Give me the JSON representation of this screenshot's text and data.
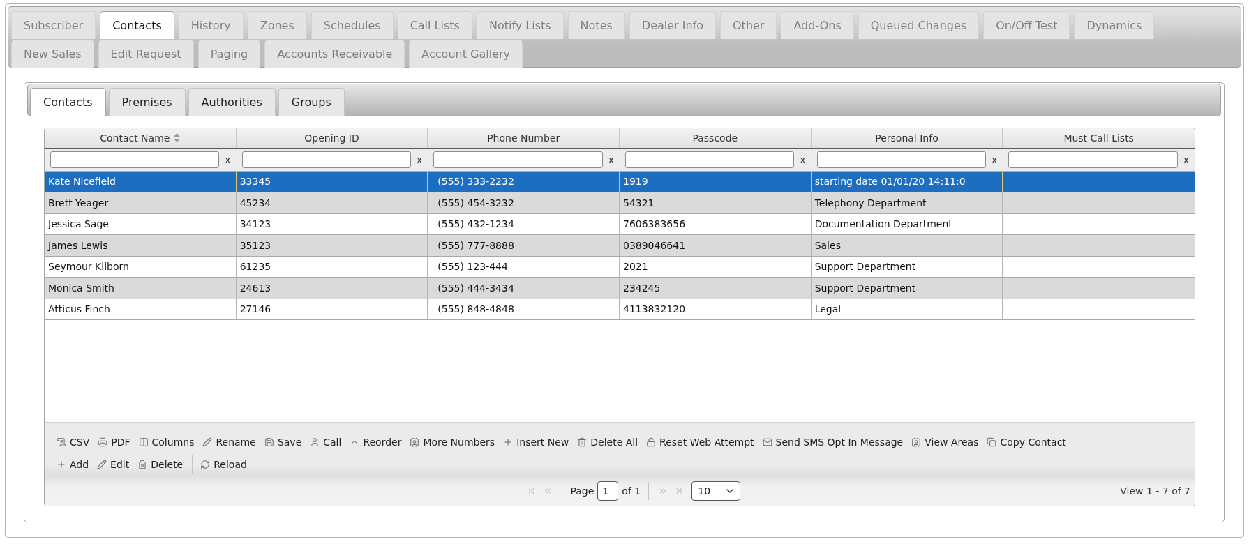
{
  "account_tabs": [
    {
      "label": "Subscriber",
      "selected": false
    },
    {
      "label": "Contacts",
      "selected": true
    },
    {
      "label": "History",
      "selected": false
    },
    {
      "label": "Zones",
      "selected": false
    },
    {
      "label": "Schedules",
      "selected": false
    },
    {
      "label": "Call Lists",
      "selected": false
    },
    {
      "label": "Notify Lists",
      "selected": false
    },
    {
      "label": "Notes",
      "selected": false
    },
    {
      "label": "Dealer Info",
      "selected": false
    },
    {
      "label": "Other",
      "selected": false
    },
    {
      "label": "Add-Ons",
      "selected": false
    },
    {
      "label": "Queued Changes",
      "selected": false
    },
    {
      "label": "On/Off Test",
      "selected": false
    },
    {
      "label": "Dynamics",
      "selected": false
    },
    {
      "label": "New Sales",
      "selected": false
    },
    {
      "label": "Edit Request",
      "selected": false
    },
    {
      "label": "Paging",
      "selected": false
    },
    {
      "label": "Accounts Receivable",
      "selected": false
    },
    {
      "label": "Account Gallery",
      "selected": false
    }
  ],
  "contact_tabs": [
    {
      "label": "Contacts",
      "selected": true
    },
    {
      "label": "Premises",
      "selected": false
    },
    {
      "label": "Authorities",
      "selected": false
    },
    {
      "label": "Groups",
      "selected": false
    }
  ],
  "grid": {
    "columns": [
      {
        "label": "Contact Name",
        "sorted": true,
        "filter": {
          "clear": "x"
        }
      },
      {
        "label": "Opening ID",
        "sorted": false,
        "filter": {
          "clear": "x"
        }
      },
      {
        "label": "Phone Number",
        "sorted": false,
        "filter": {
          "clear": "x"
        }
      },
      {
        "label": "Passcode",
        "sorted": false,
        "filter": {
          "clear": "x"
        }
      },
      {
        "label": "Personal Info",
        "sorted": false,
        "filter": {
          "clear": "x"
        }
      },
      {
        "label": "Must Call Lists",
        "sorted": false,
        "filter": {
          "clear": "x"
        }
      }
    ],
    "rows": [
      {
        "selected": true,
        "cells": [
          "Kate Nicefield",
          "33345",
          "(555) 333-2232",
          "1919",
          "starting date 01/01/20 14:11:0"
        ]
      },
      {
        "selected": false,
        "cells": [
          "Brett Yeager",
          "45234",
          "(555) 454-3232",
          "54321",
          "Telephony Department"
        ]
      },
      {
        "selected": false,
        "cells": [
          "Jessica Sage",
          "34123",
          "(555) 432-1234",
          "7606383656",
          "Documentation Department"
        ]
      },
      {
        "selected": false,
        "cells": [
          "James Lewis",
          "35123",
          "(555) 777-8888",
          "0389046641",
          "Sales"
        ]
      },
      {
        "selected": false,
        "cells": [
          "Seymour Kilborn",
          "61235",
          "(555) 123-444",
          "2021",
          "Support Department"
        ]
      },
      {
        "selected": false,
        "cells": [
          "Monica Smith",
          "24613",
          "(555) 444-3434",
          "234245",
          "Support Department"
        ]
      },
      {
        "selected": false,
        "cells": [
          "Atticus Finch",
          "27146",
          "(555) 848-4848",
          "4113832120",
          "Legal"
        ]
      }
    ]
  },
  "toolbar": {
    "rows": [
      {
        "groups": [
          [
            "CSV",
            "PDF",
            "Columns",
            "Rename",
            "Save",
            "Call",
            "Reorder",
            "More Numbers",
            "Insert New",
            "Delete All",
            "Reset Web Attempt",
            "Send SMS Opt In Message",
            "View Areas",
            "Copy Contact"
          ]
        ]
      },
      {
        "groups": [
          [
            "Add",
            "Edit",
            "Delete"
          ],
          [
            "Reload"
          ]
        ]
      }
    ]
  },
  "pager": {
    "first": {
      "disabled": true
    },
    "previous": {
      "disabled": true
    },
    "page_label": "Page",
    "page": "1",
    "page_count": "of 1",
    "next": {
      "disabled": true
    },
    "last": {
      "disabled": true
    },
    "page_size": "10",
    "summary": "View 1 - 7 of 7"
  }
}
